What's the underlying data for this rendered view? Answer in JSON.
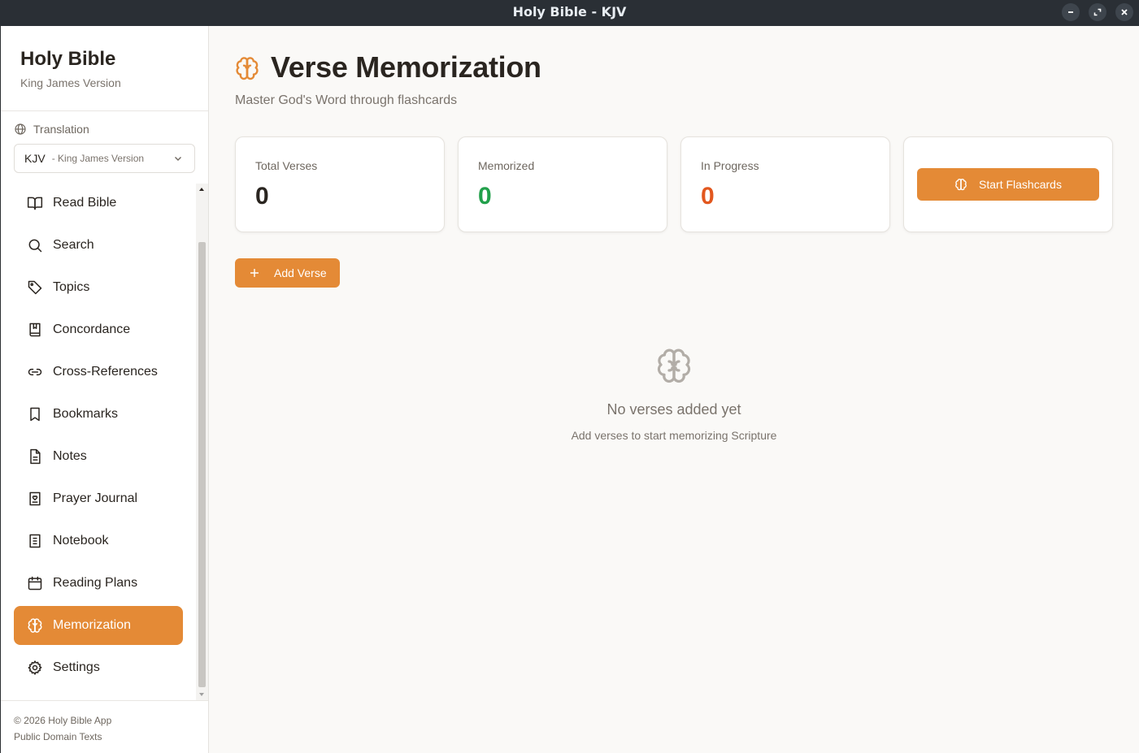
{
  "window": {
    "title": "Holy Bible - KJV",
    "controls": [
      "minimize",
      "maximize",
      "close"
    ]
  },
  "sidebar": {
    "app_title": "Holy Bible",
    "app_subtitle": "King James Version",
    "translation_label": "Translation",
    "translation_select": {
      "code": "KJV",
      "name": "- King James Version"
    },
    "items": [
      {
        "label": "Read Bible",
        "icon": "book-open-icon",
        "active": false
      },
      {
        "label": "Search",
        "icon": "search-icon",
        "active": false
      },
      {
        "label": "Topics",
        "icon": "tag-icon",
        "active": false
      },
      {
        "label": "Concordance",
        "icon": "book-bookmark-icon",
        "active": false
      },
      {
        "label": "Cross-References",
        "icon": "link-icon",
        "active": false
      },
      {
        "label": "Bookmarks",
        "icon": "bookmark-icon",
        "active": false
      },
      {
        "label": "Notes",
        "icon": "file-text-icon",
        "active": false
      },
      {
        "label": "Prayer Journal",
        "icon": "heart-book-icon",
        "active": false
      },
      {
        "label": "Notebook",
        "icon": "notebook-icon",
        "active": false
      },
      {
        "label": "Reading Plans",
        "icon": "calendar-icon",
        "active": false
      },
      {
        "label": "Memorization",
        "icon": "brain-icon",
        "active": true
      },
      {
        "label": "Settings",
        "icon": "gear-icon",
        "active": false
      }
    ],
    "footer": {
      "copyright": "© 2026 Holy Bible App",
      "license": "Public Domain Texts"
    }
  },
  "main": {
    "title": "Verse Memorization",
    "subtitle": "Master God's Word through flashcards",
    "stats": [
      {
        "label": "Total Verses",
        "value": "0",
        "color": "#2a2520"
      },
      {
        "label": "Memorized",
        "value": "0",
        "color": "#22a04b"
      },
      {
        "label": "In Progress",
        "value": "0",
        "color": "#e2571e"
      }
    ],
    "start_button": "Start Flashcards",
    "add_button": "Add Verse",
    "empty_state": {
      "title": "No verses added yet",
      "subtitle": "Add verses to start memorizing Scripture"
    }
  },
  "colors": {
    "accent": "#e48a36",
    "memorized": "#22a04b",
    "in_progress": "#e2571e"
  }
}
